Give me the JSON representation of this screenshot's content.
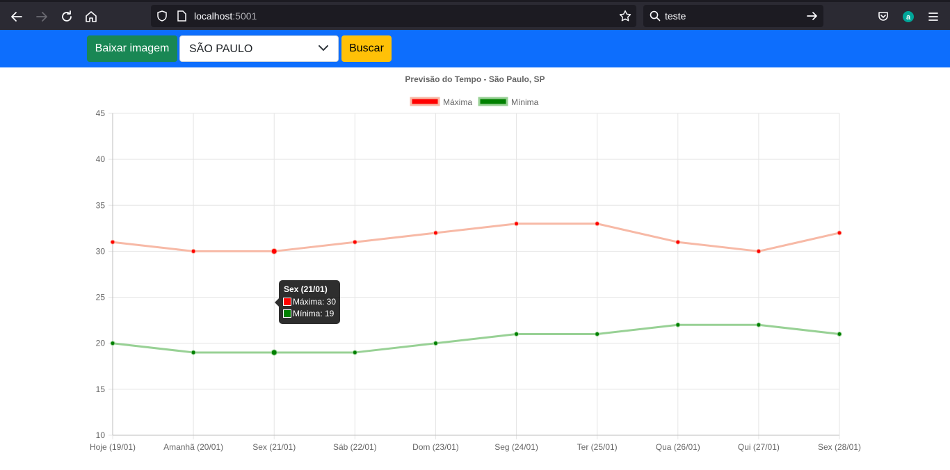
{
  "browser": {
    "url_host": "localhost",
    "url_port": ":5001",
    "search_query": "teste"
  },
  "toolbar": {
    "download_label": "Baixar imagem",
    "city_selected": "SÃO PAULO",
    "search_label": "Buscar"
  },
  "colors": {
    "max_line": "#f7b9a6",
    "max_point": "#ff0000",
    "min_line": "#98d195",
    "min_point": "#008000",
    "app_bar": "#0d6efd"
  },
  "tooltip": {
    "title": "Sex (21/01)",
    "max_text": "Máxima: 30",
    "min_text": "Mínima: 19"
  },
  "chart_data": {
    "type": "line",
    "title": "Previsão do Tempo - São Paulo, SP",
    "categories": [
      "Hoje (19/01)",
      "Amanhã (20/01)",
      "Sex (21/01)",
      "Sáb (22/01)",
      "Dom (23/01)",
      "Seg (24/01)",
      "Ter (25/01)",
      "Qua (26/01)",
      "Qui (27/01)",
      "Sex (28/01)"
    ],
    "series": [
      {
        "name": "Máxima",
        "values": [
          31,
          30,
          30,
          31,
          32,
          33,
          33,
          31,
          30,
          32
        ]
      },
      {
        "name": "Mínima",
        "values": [
          20,
          19,
          19,
          19,
          20,
          21,
          21,
          22,
          22,
          21
        ]
      }
    ],
    "ylim": [
      10,
      45
    ],
    "yticks": [
      10,
      15,
      20,
      25,
      30,
      35,
      40,
      45
    ],
    "grid": true,
    "legend": "top",
    "xlabel": "",
    "ylabel": ""
  }
}
